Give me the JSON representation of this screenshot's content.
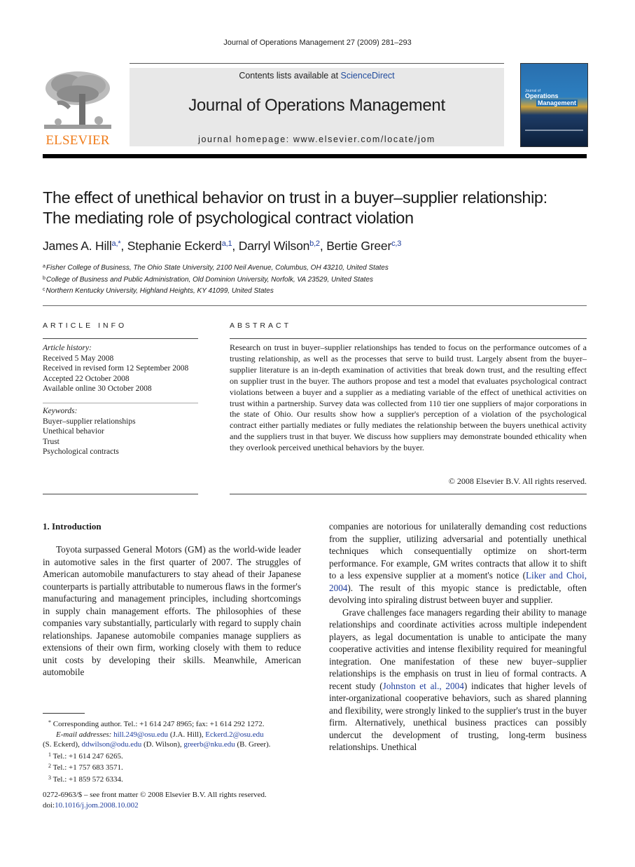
{
  "running_head": "Journal of Operations Management 27 (2009) 281–293",
  "publisher": {
    "logo_word": "ELSEVIER"
  },
  "banner": {
    "contents_prefix": "Contents lists available at ",
    "contents_link": "ScienceDirect",
    "journal_name": "Journal of Operations Management",
    "homepage": "journal homepage: www.elsevier.com/locate/jom"
  },
  "cover": {
    "line1": "Journal of",
    "line2": "Operations",
    "line3": "Management"
  },
  "article": {
    "title_line1": "The effect of unethical behavior on trust in a buyer–supplier relationship:",
    "title_line2": "The mediating role of psychological contract violation",
    "authors": [
      {
        "name": "James A. Hill",
        "sup": "a,*",
        "sep": ", "
      },
      {
        "name": "Stephanie Eckerd",
        "sup": "a,1",
        "sep": ", "
      },
      {
        "name": "Darryl Wilson",
        "sup": "b,2",
        "sep": ", "
      },
      {
        "name": "Bertie Greer",
        "sup": "c,3",
        "sep": ""
      }
    ],
    "affiliations": [
      {
        "key": "a",
        "text": "Fisher College of Business, The Ohio State University, 2100 Neil Avenue, Columbus, OH 43210, United States"
      },
      {
        "key": "b",
        "text": "College of Business and Public Administration, Old Dominion University, Norfolk, VA 23529, United States"
      },
      {
        "key": "c",
        "text": "Northern Kentucky University, Highland Heights, KY 41099, United States"
      }
    ]
  },
  "article_info": {
    "heading": "ARTICLE INFO",
    "history_label": "Article history:",
    "history": [
      "Received 5 May 2008",
      "Received in revised form 12 September 2008",
      "Accepted 22 October 2008",
      "Available online 30 October 2008"
    ],
    "keywords_label": "Keywords:",
    "keywords": [
      "Buyer–supplier relationships",
      "Unethical behavior",
      "Trust",
      "Psychological contracts"
    ]
  },
  "abstract": {
    "heading": "ABSTRACT",
    "text": "Research on trust in buyer–supplier relationships has tended to focus on the performance outcomes of a trusting relationship, as well as the processes that serve to build trust. Largely absent from the buyer–supplier literature is an in-depth examination of activities that break down trust, and the resulting effect on supplier trust in the buyer. The authors propose and test a model that evaluates psychological contract violations between a buyer and a supplier as a mediating variable of the effect of unethical activities on trust within a partnership. Survey data was collected from 110 tier one suppliers of major corporations in the state of Ohio. Our results show how a supplier's perception of a violation of the psychological contract either partially mediates or fully mediates the relationship between the buyers unethical activity and the suppliers trust in that buyer. We discuss how suppliers may demonstrate bounded ethicality when they overlook perceived unethical behaviors by the buyer.",
    "copyright": "© 2008 Elsevier B.V. All rights reserved."
  },
  "introduction": {
    "heading": "1.  Introduction",
    "left_para": "Toyota surpassed General Motors (GM) as the world-wide leader in automotive sales in the first quarter of 2007. The struggles of American automobile manufacturers to stay ahead of their Japanese counterparts is partially attributable to numerous flaws in the former's manufacturing and management principles, including shortcomings in supply chain management efforts. The philosophies of these companies vary substantially, particularly with regard to supply chain relationships. Japanese automobile companies manage suppliers as extensions of their own firm, working closely with them to reduce unit costs by developing their skills. Meanwhile, American automobile",
    "right_para1_before": "companies are notorious for unilaterally demanding cost reductions from the supplier, utilizing adversarial and potentially unethical techniques which consequentially optimize on short-term performance. For example, GM writes contracts that allow it to shift to a less expensive supplier at a moment's notice (",
    "right_para1_cite": "Liker and Choi, 2004",
    "right_para1_after": "). The result of this myopic stance is predictable, often devolving into spiraling distrust between buyer and supplier.",
    "right_para2_before": "Grave challenges face managers regarding their ability to manage relationships and coordinate activities across multiple independent players, as legal documentation is unable to anticipate the many cooperative activities and intense flexibility required for meaningful integration. One manifestation of these new buyer–supplier relationships is the emphasis on trust in lieu of formal contracts. A recent study (",
    "right_para2_cite": "Johnston et al., 2004",
    "right_para2_after": ") indicates that higher levels of inter-organizational cooperative behaviors, such as shared planning and flexibility, were strongly linked to the supplier's trust in the buyer firm. Alternatively, unethical business practices can possibly undercut the development of trusting, long-term business relationships. Unethical"
  },
  "footnotes": {
    "corresponding_mark": "*",
    "corresponding": "Corresponding author. Tel.: +1 614 247 8965; fax: +1 614 292 1272.",
    "email_label": "E-mail addresses:",
    "emails": [
      {
        "addr": "hill.249@osu.edu",
        "who": " (J.A. Hill), "
      },
      {
        "addr": "Eckerd.2@osu.edu",
        "who": ""
      },
      {
        "addr": "",
        "who": "(S. Eckerd), "
      },
      {
        "addr": "ddwilson@odu.edu",
        "who": " (D. Wilson), "
      },
      {
        "addr": "greerb@nku.edu",
        "who": " (B. Greer)."
      }
    ],
    "notes": [
      {
        "mark": "1",
        "text": "Tel.: +1 614 247 6265."
      },
      {
        "mark": "2",
        "text": "Tel.: +1 757 683 3571."
      },
      {
        "mark": "3",
        "text": "Tel.: +1 859 572 6334."
      }
    ]
  },
  "front_matter": {
    "issn_line": "0272-6963/$ – see front matter © 2008 Elsevier B.V. All rights reserved.",
    "doi_label": "doi:",
    "doi": "10.1016/j.jom.2008.10.002"
  }
}
